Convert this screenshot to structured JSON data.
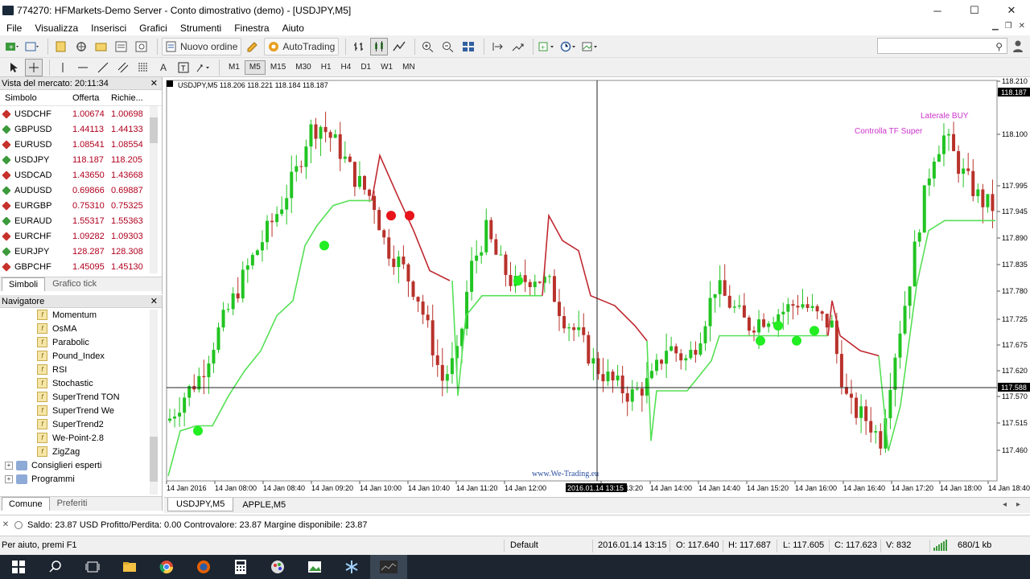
{
  "window": {
    "title": "774270: HFMarkets-Demo Server - Conto dimostrativo (demo) - [USDJPY,M5]",
    "min": "─",
    "max": "☐",
    "close": "✕"
  },
  "menu": [
    "File",
    "Visualizza",
    "Inserisci",
    "Grafici",
    "Strumenti",
    "Finestra",
    "Aiuto"
  ],
  "toolbar": {
    "new_order": "Nuovo ordine",
    "autotrading": "AutoTrading"
  },
  "timeframes": [
    "M1",
    "M5",
    "M15",
    "M30",
    "H1",
    "H4",
    "D1",
    "W1",
    "MN"
  ],
  "active_timeframe": "M5",
  "market_watch": {
    "title": "Vista del mercato: 20:11:34",
    "columns": [
      "Simbolo",
      "Offerta",
      "Richie..."
    ],
    "rows": [
      {
        "symbol": "USDCHF",
        "bid": "1.00674",
        "ask": "1.00698"
      },
      {
        "symbol": "GBPUSD",
        "bid": "1.44113",
        "ask": "1.44133"
      },
      {
        "symbol": "EURUSD",
        "bid": "1.08541",
        "ask": "1.08554"
      },
      {
        "symbol": "USDJPY",
        "bid": "118.187",
        "ask": "118.205"
      },
      {
        "symbol": "USDCAD",
        "bid": "1.43650",
        "ask": "1.43668"
      },
      {
        "symbol": "AUDUSD",
        "bid": "0.69866",
        "ask": "0.69887"
      },
      {
        "symbol": "EURGBP",
        "bid": "0.75310",
        "ask": "0.75325"
      },
      {
        "symbol": "EURAUD",
        "bid": "1.55317",
        "ask": "1.55363"
      },
      {
        "symbol": "EURCHF",
        "bid": "1.09282",
        "ask": "1.09303"
      },
      {
        "symbol": "EURJPY",
        "bid": "128.287",
        "ask": "128.308"
      },
      {
        "symbol": "GBPCHF",
        "bid": "1.45095",
        "ask": "1.45130"
      }
    ],
    "tabs": [
      "Simboli",
      "Grafico tick"
    ]
  },
  "navigator": {
    "title": "Navigatore",
    "items": [
      "Momentum",
      "OsMA",
      "Parabolic",
      "Pound_Index",
      "RSI",
      "Stochastic",
      "SuperTrend TON",
      "SuperTrend We",
      "SuperTrend2",
      "We-Point-2.8",
      "ZigZag"
    ],
    "folders": [
      "Consiglieri esperti",
      "Programmi"
    ],
    "tabs": [
      "Comune",
      "Preferiti"
    ]
  },
  "chart": {
    "header": "USDJPY,M5  118.206 118.221 118.184 118.187",
    "label_buy": "Laterale BUY",
    "label_tf": "Controlla TF Super",
    "watermark": "www.We-Trading.eu",
    "price_labels": [
      "118.210",
      "118.100",
      "117.995",
      "117.945",
      "117.890",
      "117.835",
      "117.780",
      "117.725",
      "117.675",
      "117.620",
      "117.570",
      "117.515",
      "117.460"
    ],
    "current_price": "118.187",
    "crosshair_price": "117.588",
    "time_labels": [
      "14 Jan 2016",
      "14 Jan 08:00",
      "14 Jan 08:40",
      "14 Jan 09:20",
      "14 Jan 10:00",
      "14 Jan 10:40",
      "14 Jan 11:20",
      "14 Jan 12:00",
      "14 Jan 13:20",
      "14 Jan 14:00",
      "14 Jan 14:40",
      "14 Jan 15:20",
      "14 Jan 16:00",
      "14 Jan 16:40",
      "14 Jan 17:20",
      "14 Jan 18:00",
      "14 Jan 18:40"
    ],
    "crosshair_time": "2016.01.14 13:15",
    "tabs": [
      "USDJPY,M5",
      "APPLE,M5"
    ]
  },
  "chart_data": {
    "type": "candlestick",
    "symbol": "USDJPY",
    "timeframe": "M5",
    "ylim": [
      117.43,
      118.23
    ],
    "colors": {
      "bull": "#22c422",
      "bear": "#b8322b",
      "trend_up": "#55e055",
      "trend_down": "#c0282f",
      "dot_buy": "#22ee22",
      "dot_sell": "#e8141c",
      "label": "#cc33cc"
    }
  },
  "terminal": {
    "text": "Saldo: 23.87 USD  Profitto/Perdita: 0.00  Controvalore: 23.87  Margine disponibile: 23.87"
  },
  "status": {
    "help": "Per aiuto, premi F1",
    "profile": "Default",
    "datetime": "2016.01.14 13:15",
    "open": "O: 117.640",
    "high": "H: 117.687",
    "low": "L: 117.605",
    "close": "C: 117.623",
    "volume": "V: 832",
    "traffic": "680/1 kb"
  }
}
